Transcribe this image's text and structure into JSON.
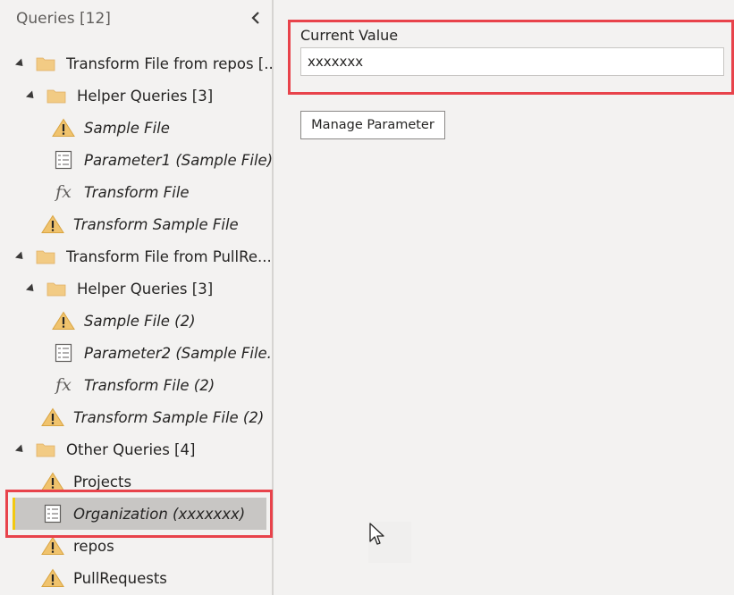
{
  "queries_pane": {
    "title": "Queries [12]",
    "tree": [
      {
        "kind": "folder",
        "level": 0,
        "label": "Transform File from repos [..."
      },
      {
        "kind": "folder",
        "level": 1,
        "label": "Helper Queries [3]"
      },
      {
        "kind": "query",
        "level": 2,
        "icon": "warning-icon",
        "label": "Sample File",
        "italic": true
      },
      {
        "kind": "query",
        "level": 2,
        "icon": "parameter-icon",
        "label": "Parameter1 (Sample File)",
        "italic": true
      },
      {
        "kind": "query",
        "level": 2,
        "icon": "function-icon",
        "label": "Transform File",
        "italic": true
      },
      {
        "kind": "query",
        "level": 1,
        "icon": "warning-icon",
        "label": "Transform Sample File",
        "italic": true
      },
      {
        "kind": "folder",
        "level": 0,
        "label": "Transform File from PullRe..."
      },
      {
        "kind": "folder",
        "level": 1,
        "label": "Helper Queries [3]"
      },
      {
        "kind": "query",
        "level": 2,
        "icon": "warning-icon",
        "label": "Sample File (2)",
        "italic": true
      },
      {
        "kind": "query",
        "level": 2,
        "icon": "parameter-icon",
        "label": "Parameter2 (Sample File...",
        "italic": true
      },
      {
        "kind": "query",
        "level": 2,
        "icon": "function-icon",
        "label": "Transform File (2)",
        "italic": true
      },
      {
        "kind": "query",
        "level": 1,
        "icon": "warning-icon",
        "label": "Transform Sample File (2)",
        "italic": true
      },
      {
        "kind": "folder",
        "level": 0,
        "label": "Other Queries [4]"
      },
      {
        "kind": "query",
        "level": 1,
        "icon": "warning-icon",
        "label": "Projects",
        "italic": false
      },
      {
        "kind": "query",
        "level": 1,
        "icon": "parameter-icon",
        "label": "Organization (xxxxxxx)",
        "italic": true,
        "selected": true
      },
      {
        "kind": "query",
        "level": 1,
        "icon": "warning-icon",
        "label": "repos",
        "italic": false
      },
      {
        "kind": "query",
        "level": 1,
        "icon": "warning-icon",
        "label": "PullRequests",
        "italic": false
      }
    ]
  },
  "parameter": {
    "current_value_label": "Current Value",
    "current_value": "xxxxxxx",
    "manage_button_label": "Manage Parameter"
  },
  "colors": {
    "highlight": "#e8434b",
    "selection": "#c8c6c4",
    "selection_accent": "#f2c811",
    "folder": "#f2cb84",
    "warning": "#f0c36d"
  }
}
